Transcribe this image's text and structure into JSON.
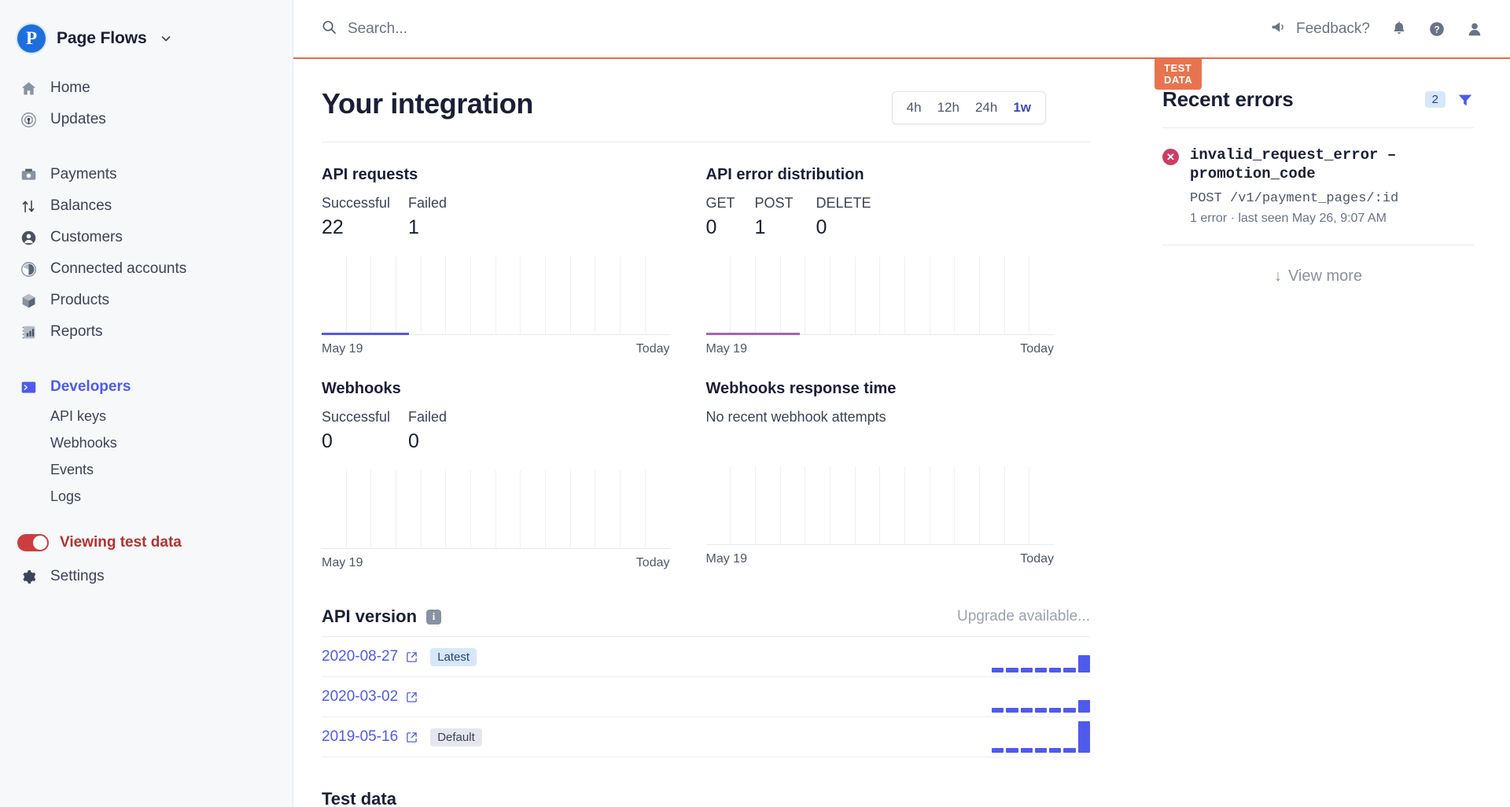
{
  "sidebar": {
    "brand": {
      "initial": "P",
      "name": "Page Flows",
      "caret": "chevron-down-icon"
    },
    "primary": [
      {
        "label": "Home",
        "icon": "home-icon"
      },
      {
        "label": "Updates",
        "icon": "updates-icon"
      }
    ],
    "secondary": [
      {
        "label": "Payments",
        "icon": "payments-icon"
      },
      {
        "label": "Balances",
        "icon": "balances-icon"
      },
      {
        "label": "Customers",
        "icon": "customers-icon"
      },
      {
        "label": "Connected accounts",
        "icon": "connected-accounts-icon"
      },
      {
        "label": "Products",
        "icon": "products-icon"
      },
      {
        "label": "Reports",
        "icon": "reports-icon"
      }
    ],
    "developers": {
      "label": "Developers",
      "icon": "terminal-icon",
      "active": true
    },
    "developers_sub": [
      {
        "label": "API keys"
      },
      {
        "label": "Webhooks"
      },
      {
        "label": "Events"
      },
      {
        "label": "Logs"
      }
    ],
    "test_data_toggle": {
      "label": "Viewing test data",
      "on": true,
      "color": "#b3332f"
    },
    "settings": {
      "label": "Settings",
      "icon": "gear-icon"
    }
  },
  "topbar": {
    "search_placeholder": "Search...",
    "search_icon": "search-icon",
    "feedback_label": "Feedback?",
    "feedback_icon": "megaphone-icon",
    "icons": [
      "bell-icon",
      "help-icon",
      "account-icon"
    ]
  },
  "page": {
    "test_badge": "TEST DATA",
    "title": "Your integration",
    "ranges": [
      {
        "label": "4h",
        "active": false
      },
      {
        "label": "12h",
        "active": false
      },
      {
        "label": "24h",
        "active": false
      },
      {
        "label": "1w",
        "active": true
      }
    ]
  },
  "metrics": [
    {
      "title": "API requests",
      "series": [
        {
          "label": "Successful",
          "value": "22"
        },
        {
          "label": "Failed",
          "value": "1"
        }
      ],
      "axis_start": "May 19",
      "axis_end": "Today",
      "line_color": "#4f5aed",
      "line_width_pct": 25
    },
    {
      "title": "API error distribution",
      "series": [
        {
          "label": "GET",
          "value": "0"
        },
        {
          "label": "POST",
          "value": "1"
        },
        {
          "label": "DELETE",
          "value": "0"
        }
      ],
      "axis_start": "May 19",
      "axis_end": "Today",
      "line_color": "#a960b8",
      "line_width_pct": 27
    },
    {
      "title": "Webhooks",
      "series": [
        {
          "label": "Successful",
          "value": "0"
        },
        {
          "label": "Failed",
          "value": "0"
        }
      ],
      "axis_start": "May 19",
      "axis_end": "Today",
      "line_color": "transparent",
      "line_width_pct": 0
    },
    {
      "title": "Webhooks response time",
      "empty_note": "No recent webhook attempts",
      "series": [],
      "axis_start": "May 19",
      "axis_end": "Today",
      "line_color": "transparent",
      "line_width_pct": 0
    }
  ],
  "api_version": {
    "title": "API version",
    "info_icon": "info-icon",
    "upgrade_label": "Upgrade available...",
    "rows": [
      {
        "date": "2020-08-27",
        "tag": "Latest",
        "tag_style": "latest",
        "bars": [
          6,
          6,
          6,
          6,
          6,
          6,
          22
        ]
      },
      {
        "date": "2020-03-02",
        "tag": "",
        "tag_style": "",
        "bars": [
          6,
          6,
          6,
          6,
          6,
          6,
          16
        ]
      },
      {
        "date": "2019-05-16",
        "tag": "Default",
        "tag_style": "default",
        "bars": [
          6,
          6,
          6,
          6,
          6,
          6,
          40
        ]
      }
    ]
  },
  "test_data_section": {
    "title": "Test data"
  },
  "recent_errors": {
    "title": "Recent errors",
    "count": "2",
    "filter_icon": "filter-icon",
    "items": [
      {
        "title": "invalid_request_error – promotion_code",
        "path": "POST /v1/payment_pages/:id",
        "meta": "1 error · last seen May 26, 9:07 AM"
      }
    ],
    "view_more": "View more"
  }
}
